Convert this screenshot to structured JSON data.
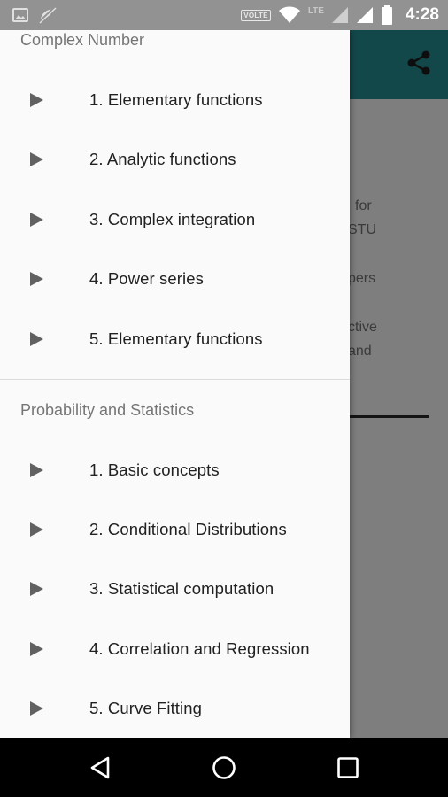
{
  "status_bar": {
    "time": "4:28",
    "volte": "VOLTE",
    "network": "LTE"
  },
  "app": {
    "share_icon": "share-icon",
    "background_text": [
      "for",
      "STU",
      "pers",
      "ctive",
      "and"
    ]
  },
  "drawer": {
    "sections": [
      {
        "header": "Complex Number",
        "items": [
          "1. Elementary functions",
          "2. Analytic functions",
          "3. Complex integration",
          "4. Power series",
          "5. Elementary functions"
        ]
      },
      {
        "header": "Probability and Statistics",
        "items": [
          "1. Basic concepts",
          "2. Conditional Distributions",
          "3. Statistical computation",
          "4. Correlation and Regression",
          "5. Curve Fitting"
        ]
      }
    ]
  },
  "colors": {
    "toolbar": "#13484a",
    "drawer_bg": "#fafafa",
    "header_text": "#757575",
    "item_text": "#212121",
    "icon": "#616161"
  },
  "icons": {
    "item": "play-arrow-icon",
    "back": "back-icon",
    "home": "home-icon",
    "recents": "recents-icon"
  }
}
